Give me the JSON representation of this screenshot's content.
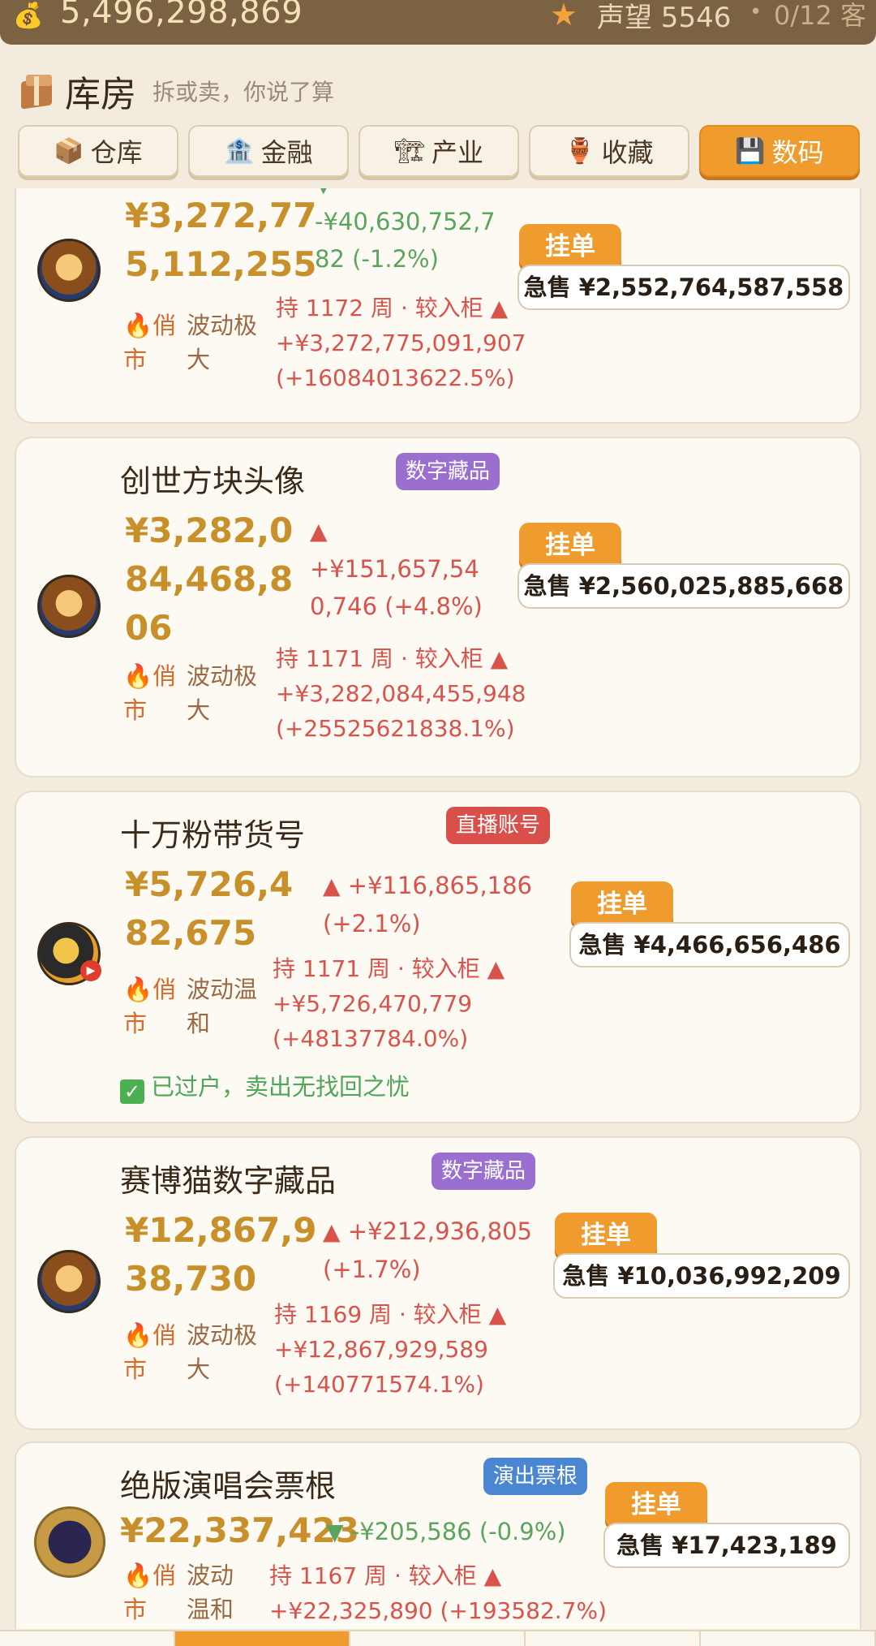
{
  "topbar": {
    "money": "5,496,298,869",
    "reputation": "声望 5546",
    "guests": "0/12 客"
  },
  "header": {
    "title": "库房",
    "subtitle": "拆或卖，你说了算"
  },
  "tabs": [
    {
      "label": "仓库",
      "icon": "package-icon"
    },
    {
      "label": "金融",
      "icon": "bank-icon"
    },
    {
      "label": "产业",
      "icon": "crane-icon"
    },
    {
      "label": "收藏",
      "icon": "vase-icon"
    },
    {
      "label": "数码",
      "icon": "floppy-icon",
      "active": true
    }
  ],
  "items": [
    {
      "name": "",
      "price_l1": "¥3,272,77",
      "price_l2": "5,112,255",
      "change_l1": "-¥40,630,752,7",
      "change_l2": "82 (-1.2%)",
      "direction": "down",
      "heat_l1": "🔥俏",
      "heat_l2": "市",
      "vol_l1": "波动极",
      "vol_l2": "大",
      "hold_l1": "持 1172 周 · 较入柜 ▲",
      "hold_l2": "+¥3,272,775,091,907",
      "hold_l3": "(+16084013622.5%)",
      "list_label": "挂单",
      "sell_label": "急售 ¥2,552,764,587,558"
    },
    {
      "name": "创世方块头像",
      "tag": "数字藏品",
      "price_l1": "¥3,282,0",
      "price_l2": "84,468,8",
      "price_l3": "06",
      "change_l1": "+¥151,657,54",
      "change_l2": "0,746 (+4.8%)",
      "direction": "up",
      "heat_l1": "🔥俏",
      "heat_l2": "市",
      "vol_l1": "波动极",
      "vol_l2": "大",
      "hold_l1": "持 1171 周 · 较入柜 ▲",
      "hold_l2": "+¥3,282,084,455,948",
      "hold_l3": "(+25525621838.1%)",
      "list_label": "挂单",
      "sell_label": "急售 ¥2,560,025,885,668"
    },
    {
      "name": "十万粉带货号",
      "tag": "直播账号",
      "price_l1": "¥5,726,4",
      "price_l2": "82,675",
      "change_l1": "+¥116,865,186",
      "change_l2": "(+2.1%)",
      "direction": "up",
      "heat_l1": "🔥俏",
      "heat_l2": "市",
      "vol_l1": "波动温",
      "vol_l2": "和",
      "hold_l1": "持 1171 周 · 较入柜 ▲",
      "hold_l2": "+¥5,726,470,779",
      "hold_l3": "(+48137784.0%)",
      "verified": "已过户，卖出无找回之忧",
      "list_label": "挂单",
      "sell_label": "急售 ¥4,466,656,486"
    },
    {
      "name": "赛博猫数字藏品",
      "tag": "数字藏品",
      "price_l1": "¥12,867,9",
      "price_l2": "38,730",
      "change_l1": "+¥212,936,805",
      "change_l2": "(+1.7%)",
      "direction": "up",
      "heat_l1": "🔥俏",
      "heat_l2": "市",
      "vol_l1": "波动极",
      "vol_l2": "大",
      "hold_l1": "持 1169 周 · 较入柜 ▲",
      "hold_l2": "+¥12,867,929,589",
      "hold_l3": "(+140771574.1%)",
      "list_label": "挂单",
      "sell_label": "急售 ¥10,036,992,209"
    },
    {
      "name": "绝版演唱会票根",
      "tag": "演出票根",
      "price_l1": "¥22,337,423",
      "change_l1": "-¥205,586 (-0.9%)",
      "direction": "down",
      "heat_l1": "🔥俏",
      "heat_l2": "市",
      "vol_l1": "波动",
      "vol_l2": "温和",
      "hold_l1": "持 1167 周 · 较入柜 ▲",
      "hold_l2": "+¥22,325,890 (+193582.7%)",
      "list_label": "挂单",
      "sell_label": "急售 ¥17,423,189"
    }
  ]
}
